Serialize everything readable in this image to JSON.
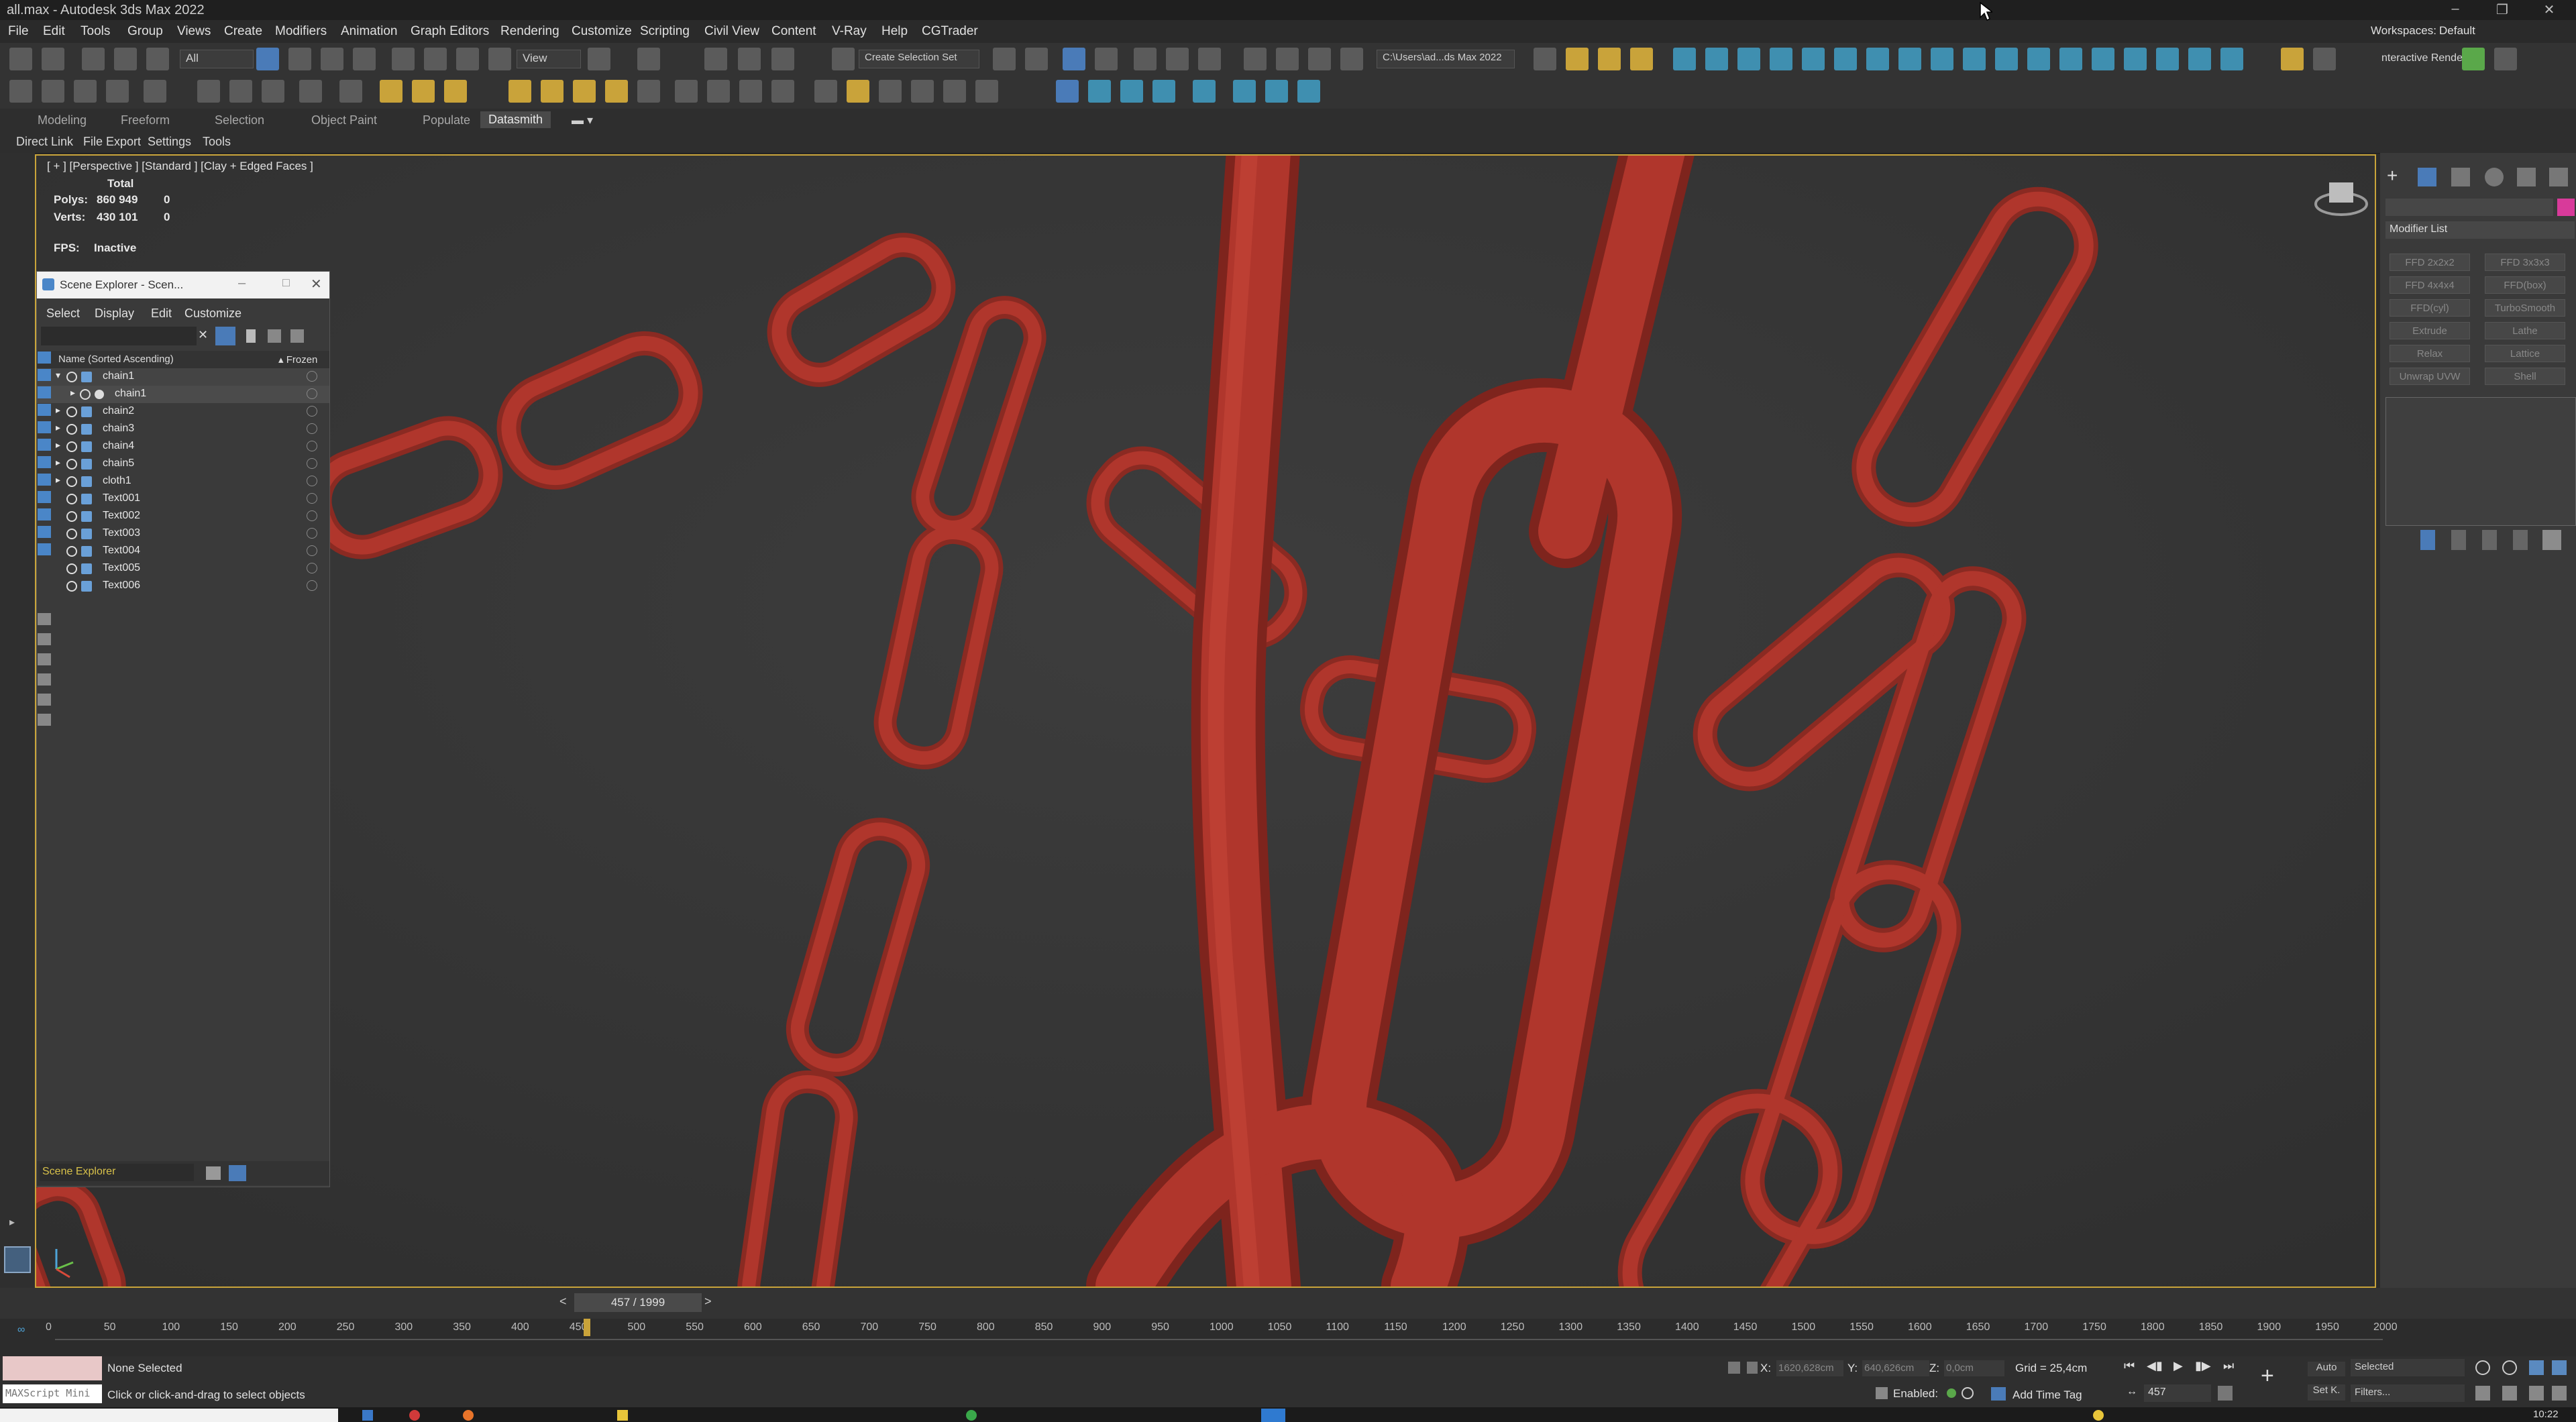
{
  "window": {
    "title": "all.max - Autodesk 3ds Max 2022"
  },
  "menu": [
    "File",
    "Edit",
    "Tools",
    "Group",
    "Views",
    "Create",
    "Modifiers",
    "Animation",
    "Graph Editors",
    "Rendering",
    "Customize",
    "Scripting",
    "Civil View",
    "Content",
    "V-Ray",
    "Help",
    "CGTrader"
  ],
  "workspace": {
    "label": "Workspaces:",
    "value": "Default"
  },
  "toolbar": {
    "filter_all": "All",
    "view_dropdown": "View",
    "selection_set": "Create Selection Set",
    "path": "C:\\Users\\ad...ds Max 2022",
    "interactive": "nteractive Render"
  },
  "ribbon_tabs": [
    "Modeling",
    "Freeform",
    "Selection",
    "Object Paint",
    "Populate",
    "Datasmith"
  ],
  "datasmith_items": [
    "Direct Link",
    "File Export",
    "Settings",
    "Tools"
  ],
  "viewport": {
    "label": "[ + ] [Perspective ] [Standard ] [Clay + Edged Faces ]",
    "stats_total": "Total",
    "polys_label": "Polys:",
    "polys_value": "860 949",
    "polys_sel": "0",
    "verts_label": "Verts:",
    "verts_value": "430 101",
    "verts_sel": "0",
    "fps_label": "FPS:",
    "fps_value": "Inactive"
  },
  "scene_explorer": {
    "title": "Scene Explorer - Scen...",
    "menu": [
      "Select",
      "Display",
      "Edit",
      "Customize"
    ],
    "col_name": "Name (Sorted Ascending)",
    "col_frozen": "▴ Frozen",
    "rows": [
      "chain1",
      "chain1",
      "chain2",
      "chain3",
      "chain4",
      "chain5",
      "cloth1",
      "Text001",
      "Text002",
      "Text003",
      "Text004",
      "Text005",
      "Text006"
    ],
    "footer": "Scene Explorer"
  },
  "command_panel": {
    "modifier_list": "Modifier List",
    "buttons": [
      "FFD 2x2x2",
      "FFD 3x3x3",
      "FFD 4x4x4",
      "FFD(box)",
      "FFD(cyl)",
      "TurboSmooth",
      "Extrude",
      "Lathe",
      "Relax",
      "Lattice",
      "Unwrap UVW",
      "Shell"
    ]
  },
  "timeline": {
    "frame_display": "457 / 1999",
    "ticks": [
      "0",
      "50",
      "100",
      "150",
      "200",
      "250",
      "300",
      "350",
      "400",
      "450",
      "500",
      "550",
      "600",
      "650",
      "700",
      "750",
      "800",
      "850",
      "900",
      "950",
      "1000",
      "1050",
      "1100",
      "1150",
      "1200",
      "1250",
      "1300",
      "1350",
      "1400",
      "1450",
      "1500",
      "1550",
      "1600",
      "1650",
      "1700",
      "1750",
      "1800",
      "1850",
      "1900",
      "1950",
      "2000"
    ],
    "current_frame": 457,
    "total_frames": 1999
  },
  "status": {
    "script_label": "MAXScript Mini",
    "selection": "None Selected",
    "hint": "Click or click-and-drag to select objects",
    "x_label": "X:",
    "x_value": "1620,628cm",
    "y_label": "Y:",
    "y_value": "640,626cm",
    "z_label": "Z:",
    "z_value": "0,0cm",
    "grid": "Grid = 25,4cm",
    "enabled": "Enabled:",
    "add_time_tag": "Add Time Tag",
    "auto": "Auto",
    "selected": "Selected",
    "setk": "Set K.",
    "filters": "Filters...",
    "frame": "457",
    "clock": "10:22"
  },
  "colors": {
    "chain": "#b0362c",
    "viewport_border": "#c9a43a",
    "background": "#2b2b2b"
  }
}
